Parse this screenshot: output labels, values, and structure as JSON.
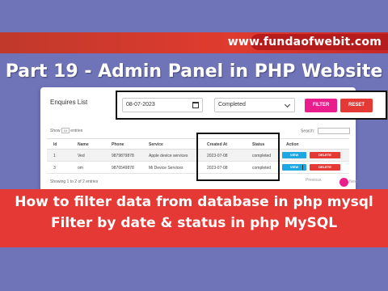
{
  "website": "www.fundaofwebit.com",
  "title": "Part 19 - Admin Panel in PHP Website",
  "panel": {
    "heading": "Enquires List",
    "filter": {
      "date_value": "08-07-2023",
      "status_value": "Completed",
      "filter_label": "FILTER",
      "reset_label": "RESET"
    },
    "show_label": "Show",
    "show_value": "10",
    "entries_label": "entries",
    "search_label": "Search:",
    "columns": [
      "Id",
      "Name",
      "Phone",
      "Service",
      "Created At",
      "Status",
      "Action"
    ],
    "rows": [
      {
        "id": "1",
        "name": "Ved",
        "phone": "9879879878",
        "service": "Apple device services",
        "created_at": "2023-07-08",
        "status": "completed",
        "view": "VIEW",
        "delete": "DELETE"
      },
      {
        "id": "3",
        "name": "om",
        "phone": "9876549878",
        "service": "Mi Device Services",
        "created_at": "2023-07-08",
        "status": "completed",
        "view": "VIEW",
        "delete": "DELETE"
      }
    ],
    "footer_info": "Showing 1 to 2 of 2 entries",
    "prev_label": "Previous",
    "next_label": "Next"
  },
  "caption": {
    "line1": "How to filter data from database in php mysql",
    "line2": "Filter by date & status in php MySQL"
  },
  "colors": {
    "background": "#6f73b8",
    "banner_red": "#e53935",
    "accent_pink": "#e91e8c",
    "view_blue": "#1ea7e1"
  }
}
